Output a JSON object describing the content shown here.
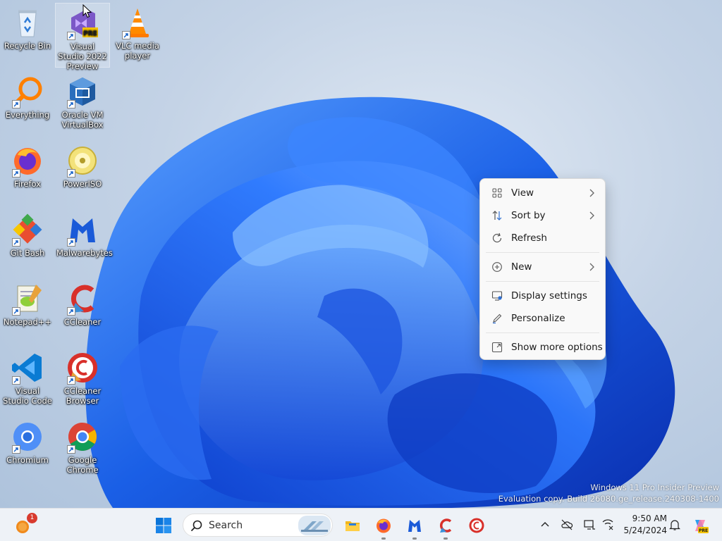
{
  "desktop": {
    "icons": [
      {
        "label": "Recycle Bin"
      },
      {
        "label": "Visual Studio 2022 Preview",
        "badge": "PRE"
      },
      {
        "label": "VLC media player"
      },
      {
        "label": "Everything"
      },
      {
        "label": "Oracle VM VirtualBox"
      },
      {
        "label": "Firefox"
      },
      {
        "label": "PowerISO"
      },
      {
        "label": "Git Bash"
      },
      {
        "label": "Malwarebytes"
      },
      {
        "label": "Notepad++"
      },
      {
        "label": "CCleaner"
      },
      {
        "label": "Visual Studio Code"
      },
      {
        "label": "CCleaner Browser"
      },
      {
        "label": "Chromium"
      },
      {
        "label": "Google Chrome"
      }
    ],
    "watermark": {
      "line1": "Windows 11 Pro Insider Preview",
      "line2": "Evaluation copy. Build 26080.ge_release.240308-1400"
    }
  },
  "context_menu": {
    "items": [
      {
        "label": "View",
        "icon": "grid-view-icon"
      },
      {
        "label": "Sort by",
        "icon": "sort-arrows-icon"
      },
      {
        "label": "Refresh",
        "icon": "refresh-icon"
      },
      {
        "label": "New",
        "icon": "plus-circle-icon"
      },
      {
        "label": "Display settings",
        "icon": "monitor-gear-icon"
      },
      {
        "label": "Personalize",
        "icon": "pencil-icon"
      },
      {
        "label": "Show more options",
        "icon": "expand-box-icon"
      }
    ]
  },
  "taskbar": {
    "widget_badge": "1",
    "search_placeholder": "Search",
    "clock": {
      "time": "9:50 AM",
      "date": "5/24/2024"
    },
    "copilot_badge": "PRE"
  },
  "colors": {
    "accent": "#0067c0",
    "bloom_blue": "#1a5fe6",
    "menu_bg": "#f9f9f9",
    "taskbar_bg": "#eef2f7"
  }
}
